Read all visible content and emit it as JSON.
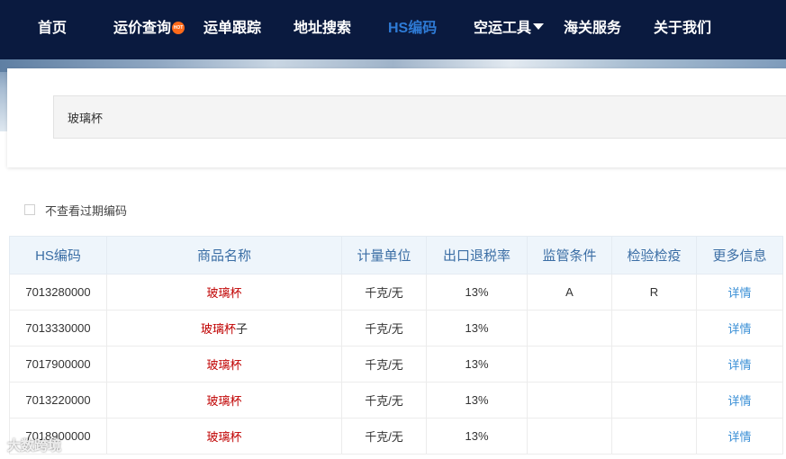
{
  "nav": {
    "items": [
      {
        "label": "首页"
      },
      {
        "label": "运价查询",
        "badge": "HOT"
      },
      {
        "label": "运单跟踪"
      },
      {
        "label": "地址搜索"
      },
      {
        "label": "HS编码",
        "active": true
      },
      {
        "label": "空运工具",
        "dropdown": true
      },
      {
        "label": "海关服务"
      },
      {
        "label": "关于我们"
      }
    ]
  },
  "search": {
    "value": "玻璃杯"
  },
  "filter": {
    "label": "不查看过期编码",
    "checked": false
  },
  "table": {
    "headers": [
      "HS编码",
      "商品名称",
      "计量单位",
      "出口退税率",
      "监管条件",
      "检验检疫",
      "更多信息"
    ],
    "rows": [
      {
        "code": "7013280000",
        "name_match": "玻璃杯",
        "name_rest": "",
        "unit": "千克/无",
        "rate": "13%",
        "supervision": "A",
        "inspection": "R",
        "more": "详情"
      },
      {
        "code": "7013330000",
        "name_match": "玻璃杯",
        "name_rest": "子",
        "unit": "千克/无",
        "rate": "13%",
        "supervision": "",
        "inspection": "",
        "more": "详情"
      },
      {
        "code": "7017900000",
        "name_match": "玻璃杯",
        "name_rest": "",
        "unit": "千克/无",
        "rate": "13%",
        "supervision": "",
        "inspection": "",
        "more": "详情"
      },
      {
        "code": "7013220000",
        "name_match": "玻璃杯",
        "name_rest": "",
        "unit": "千克/无",
        "rate": "13%",
        "supervision": "",
        "inspection": "",
        "more": "详情"
      },
      {
        "code": "7018900000",
        "name_match": "玻璃杯",
        "name_rest": "",
        "unit": "千克/无",
        "rate": "13%",
        "supervision": "",
        "inspection": "",
        "more": "详情"
      }
    ]
  },
  "watermark": "大数跨境",
  "colors": {
    "nav_bg": "#0a1a3f",
    "nav_active": "#2e7bd6",
    "match_highlight": "#c00000",
    "link": "#3a8fd6",
    "header_text": "#3b6ea5"
  }
}
